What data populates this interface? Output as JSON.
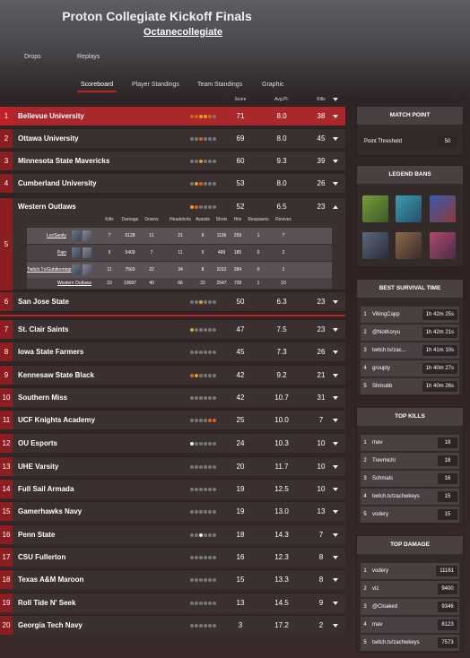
{
  "header": {
    "title": "Proton Collegiate Kickoff Finals",
    "subtitle": "Octanecollegiate",
    "nav": [
      "Drops",
      "Replays"
    ]
  },
  "tabs": [
    "Scoreboard",
    "Player Standings",
    "Team Standings",
    "Graphic"
  ],
  "columns": {
    "score": "Score",
    "avg": "Avg.Pl.",
    "kills": "Kills"
  },
  "rows": [
    {
      "rank": "1",
      "name": "Bellevue University",
      "score": "71",
      "avg": "8.0",
      "kills": "38"
    },
    {
      "rank": "2",
      "name": "Ottawa University",
      "score": "69",
      "avg": "8.0",
      "kills": "45"
    },
    {
      "rank": "3",
      "name": "Minnesota State Mavericks",
      "score": "60",
      "avg": "9.3",
      "kills": "39"
    },
    {
      "rank": "4",
      "name": "Cumberland University",
      "score": "53",
      "avg": "8.0",
      "kills": "26"
    },
    {
      "rank": "6",
      "name": "San Jose State",
      "score": "50",
      "avg": "6.3",
      "kills": "23"
    },
    {
      "rank": "7",
      "name": "St. Clair Saints",
      "score": "47",
      "avg": "7.5",
      "kills": "23"
    },
    {
      "rank": "8",
      "name": "Iowa State Farmers",
      "score": "45",
      "avg": "7.3",
      "kills": "26"
    },
    {
      "rank": "9",
      "name": "Kennesaw State Black",
      "score": "42",
      "avg": "9.2",
      "kills": "21"
    },
    {
      "rank": "10",
      "name": "Southern Miss",
      "score": "42",
      "avg": "10.7",
      "kills": "31"
    },
    {
      "rank": "11",
      "name": "UCF Knights Academy",
      "score": "25",
      "avg": "10.0",
      "kills": "7"
    },
    {
      "rank": "12",
      "name": "OU Esports",
      "score": "24",
      "avg": "10.3",
      "kills": "10"
    },
    {
      "rank": "13",
      "name": "UHE Varsity",
      "score": "20",
      "avg": "11.7",
      "kills": "10"
    },
    {
      "rank": "14",
      "name": "Full Sail Armada",
      "score": "19",
      "avg": "12.5",
      "kills": "10"
    },
    {
      "rank": "15",
      "name": "Gamerhawks Navy",
      "score": "19",
      "avg": "13.0",
      "kills": "13"
    },
    {
      "rank": "16",
      "name": "Penn State",
      "score": "18",
      "avg": "14.3",
      "kills": "7"
    },
    {
      "rank": "17",
      "name": "CSU Fullerton",
      "score": "16",
      "avg": "12.3",
      "kills": "8"
    },
    {
      "rank": "18",
      "name": "Texas A&M Maroon",
      "score": "15",
      "avg": "13.3",
      "kills": "8"
    },
    {
      "rank": "19",
      "name": "Roll Tide N' Seek",
      "score": "13",
      "avg": "14.5",
      "kills": "9"
    },
    {
      "rank": "20",
      "name": "Georgia Tech Navy",
      "score": "3",
      "avg": "17.2",
      "kills": "2"
    }
  ],
  "expanded": {
    "rank": "5",
    "name": "Western Outlaws",
    "score": "52",
    "avg": "6.5",
    "kills": "23",
    "headers": [
      "Kills",
      "Damage",
      "Downs",
      "Headshots",
      "Assists",
      "Shots",
      "Hits",
      "Respawns",
      "Revives"
    ],
    "players": [
      {
        "name": "LocSanity",
        "stats": [
          "7",
          "6128",
          "11",
          "21",
          "9",
          "1136",
          "259",
          "1",
          "7"
        ]
      },
      {
        "name": "Pain",
        "stats": [
          "5",
          "5409",
          "7",
          "11",
          "5",
          "499",
          "185",
          "0",
          "2"
        ]
      },
      {
        "name": "Twitch.Tv/Gobileontop",
        "stats": [
          "11",
          "7560",
          "22",
          "34",
          "8",
          "1012",
          "284",
          "0",
          "1"
        ]
      },
      {
        "name": "Western Outlaws",
        "stats": [
          "23",
          "19097",
          "40",
          "66",
          "22",
          "2547",
          "728",
          "1",
          "10"
        ]
      }
    ]
  },
  "match_point": {
    "title": "MATCH POINT",
    "label": "Point Threshold",
    "value": "50"
  },
  "legend_bans": {
    "title": "LEGEND BANS"
  },
  "survival": {
    "title": "BEST SURVIVAL TIME",
    "rows": [
      {
        "n": "1",
        "name": "VikingCapp",
        "val": "1h 42m 25s"
      },
      {
        "n": "2",
        "name": "@NotKoryu",
        "val": "1h 42m 21s"
      },
      {
        "n": "3",
        "name": "twitch.tv/zac...",
        "val": "1h 41m 10s"
      },
      {
        "n": "4",
        "name": "groupty",
        "val": "1h 40m 27s"
      },
      {
        "n": "5",
        "name": "Shmubb",
        "val": "1h 40m 26s"
      }
    ]
  },
  "top_kills": {
    "title": "TOP KILLS",
    "rows": [
      {
        "n": "1",
        "name": "mav",
        "val": "19"
      },
      {
        "n": "2",
        "name": "Trevmichi",
        "val": "18"
      },
      {
        "n": "3",
        "name": "Schmals",
        "val": "16"
      },
      {
        "n": "4",
        "name": "twitch.tv/zachwkeys",
        "val": "15"
      },
      {
        "n": "5",
        "name": "vodery",
        "val": "15"
      }
    ]
  },
  "top_damage": {
    "title": "TOP DAMAGE",
    "rows": [
      {
        "n": "1",
        "name": "vodery",
        "val": "11161"
      },
      {
        "n": "2",
        "name": "viz",
        "val": "9400"
      },
      {
        "n": "3",
        "name": "@Cloaked",
        "val": "9346"
      },
      {
        "n": "4",
        "name": "mav",
        "val": "8123"
      },
      {
        "n": "5",
        "name": "twitch.tv/zachwkeys",
        "val": "7573"
      }
    ]
  }
}
